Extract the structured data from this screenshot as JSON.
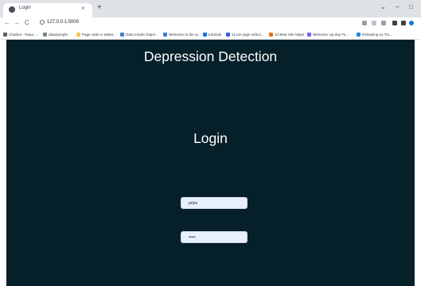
{
  "browser": {
    "tab_title": "Login",
    "tab_close": "×",
    "new_tab": "+",
    "window_controls": [
      "⌄",
      "–",
      "□"
    ],
    "nav": {
      "back": "←",
      "forward": "→",
      "reload": "C"
    },
    "url": "127.0.0.1:5000",
    "bookmarks": [
      {
        "label": "Chatbot - Rasa ...",
        "color": "#5a5f66"
      },
      {
        "label": "data/people",
        "color": "#7b868f"
      },
      {
        "label": "Page Sale in Water...",
        "color": "#f6c343"
      },
      {
        "label": "Data model chiprs...",
        "color": "#4a76c8"
      },
      {
        "label": "Welcome to the w...",
        "color": "#3a7bd5"
      },
      {
        "label": "tutorials",
        "color": "#1a73e8"
      },
      {
        "label": "11 pie page select...",
        "color": "#3b5bdb"
      },
      {
        "label": "10 Best Site Maps",
        "color": "#e8710a"
      },
      {
        "label": "Welcome Up-day To...",
        "color": "#7b61ff"
      },
      {
        "label": "Releasing ny Tru...",
        "color": "#1e88e5"
      }
    ]
  },
  "app": {
    "title": "Depression Detection",
    "login_heading": "Login",
    "username_value": "priya",
    "password_value": "•••••"
  },
  "colors": {
    "background": "#06202a",
    "heading": "#ffffff",
    "field": "#e8f0fe"
  }
}
